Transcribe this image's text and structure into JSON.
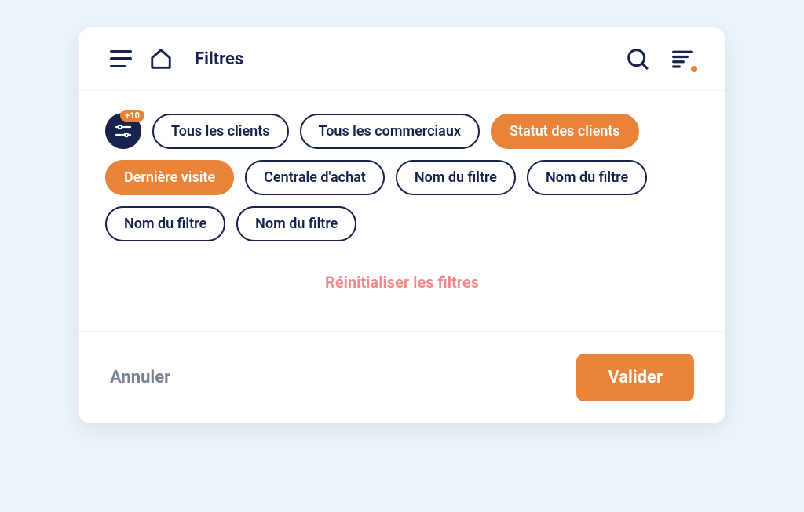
{
  "header": {
    "title": "Filtres"
  },
  "settings": {
    "badge": "+10"
  },
  "chips": [
    {
      "label": "Tous les clients",
      "active": false
    },
    {
      "label": "Tous les commerciaux",
      "active": false
    },
    {
      "label": "Statut des clients",
      "active": true
    },
    {
      "label": "Dernière visite",
      "active": true
    },
    {
      "label": "Centrale d'achat",
      "active": false
    },
    {
      "label": "Nom du filtre",
      "active": false
    },
    {
      "label": "Nom du filtre",
      "active": false
    },
    {
      "label": "Nom du filtre",
      "active": false
    },
    {
      "label": "Nom du filtre",
      "active": false
    }
  ],
  "actions": {
    "reset": "Réinitialiser les filtres",
    "cancel": "Annuler",
    "validate": "Valider"
  },
  "colors": {
    "accent": "#e8833a",
    "ink": "#17234c",
    "reset": "#f08b8b",
    "muted": "#7a8394"
  }
}
